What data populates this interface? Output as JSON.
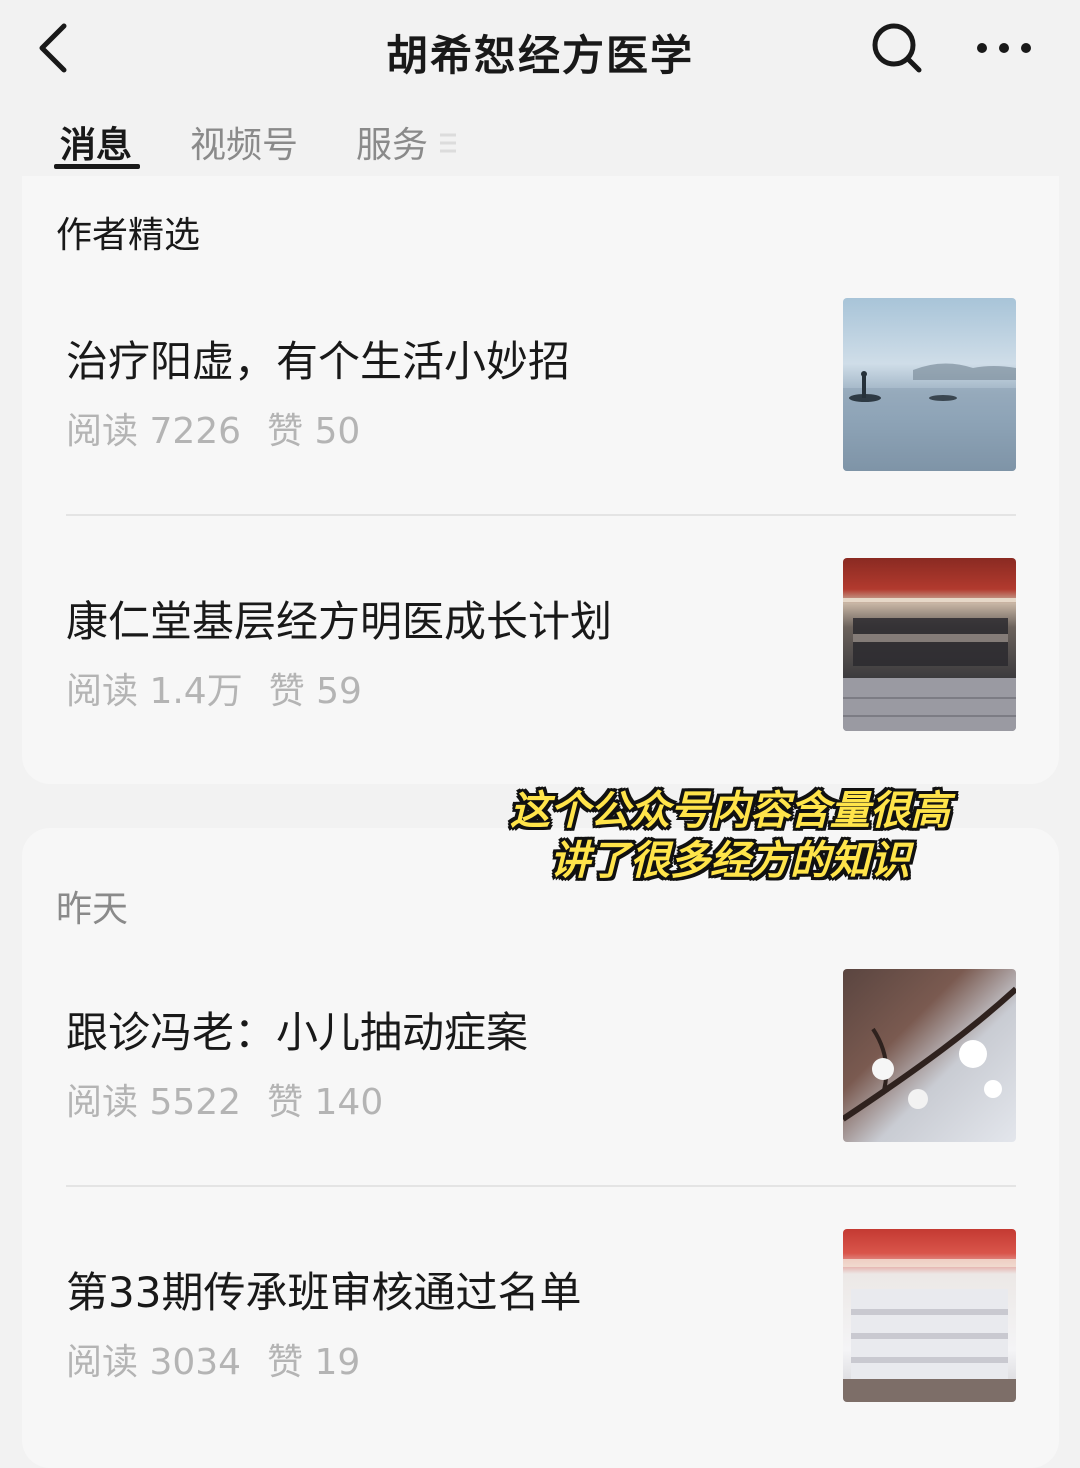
{
  "header": {
    "title": "胡希恕经方医学",
    "back_icon": "chevron-left-icon",
    "search_icon": "search-icon",
    "more_icon": "more-horizontal-icon"
  },
  "tabs": [
    {
      "label": "消息",
      "active": true
    },
    {
      "label": "视频号",
      "active": false
    },
    {
      "label": "服务",
      "active": false
    }
  ],
  "sections": [
    {
      "title": "作者精选",
      "articles": [
        {
          "title": "治疗阳虚，有个生活小妙招",
          "reads_label": "阅读 7226",
          "likes_label": "赞 50",
          "thumb": "misty-lake-photo"
        },
        {
          "title": "康仁堂基层经方明医成长计划",
          "reads_label": "阅读 1.4万",
          "likes_label": "赞 59",
          "thumb": "group-photo"
        }
      ]
    },
    {
      "title": "昨天",
      "articles": [
        {
          "title": "跟诊冯老：小儿抽动症案",
          "reads_label": "阅读 5522",
          "likes_label": "赞 140",
          "thumb": "blossom-photo"
        },
        {
          "title": "第33期传承班审核通过名单",
          "reads_label": "阅读 3034",
          "likes_label": "赞 19",
          "thumb": "class-photo"
        }
      ]
    }
  ],
  "overlay_caption": {
    "line1": "这个公众号内容含量很高",
    "line2": "讲了很多经方的知识",
    "color": "#ffe44a"
  }
}
